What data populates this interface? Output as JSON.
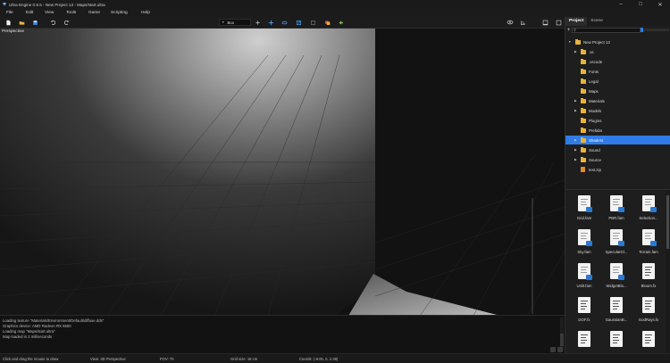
{
  "window": {
    "title": "Ultra Engine 0.9.5 - New Project 13 - Maps/start.ultra",
    "controls": [
      "–",
      "□",
      "✕"
    ]
  },
  "menu": [
    "File",
    "Edit",
    "View",
    "Tools",
    "Game",
    "Scripting",
    "Help"
  ],
  "toolbar": {
    "view_mode": "Box",
    "icons": [
      "new-file-icon",
      "open-folder-icon",
      "save-icon",
      "undo-icon",
      "redo-icon"
    ],
    "center_icons": [
      "add-icon",
      "move-icon",
      "rotate-icon",
      "scale-icon",
      "pivot-icon",
      "csg-icon",
      "run-icon"
    ],
    "right_icons": [
      "visibility-icon",
      "snap-icon",
      "layout-single-icon",
      "layout-quad-icon"
    ]
  },
  "viewport": {
    "label": "Perspective"
  },
  "console": {
    "lines": [
      "Loading texture \"Materials/Environment/Default/diffuse.dds\"",
      "Graphics device: AMD Radeon RX 6600",
      "Loading map \"Maps/start.ultra\"",
      "Map loaded in 2 milliseconds"
    ]
  },
  "statusbar": {
    "hint": "Click and drag the mouse to draw",
    "view": "View: 3D Perspective",
    "fov": "FOV: 70",
    "grid": "Grid size: 16 cm",
    "coords": "Coords: (-9.05, 0, 2.38)"
  },
  "panel": {
    "tabs": [
      "Project",
      "Scene"
    ],
    "active_tab": "Project",
    "search": {
      "placeholder": "",
      "value": ""
    },
    "tree": [
      {
        "label": "New Project 13",
        "type": "folder",
        "depth": 0,
        "expanded": true
      },
      {
        "label": ".vs",
        "type": "folder",
        "depth": 1,
        "expandable": true
      },
      {
        "label": ".vscode",
        "type": "folder",
        "depth": 1
      },
      {
        "label": "Fonts",
        "type": "folder",
        "depth": 1
      },
      {
        "label": "Legal",
        "type": "folder",
        "depth": 1
      },
      {
        "label": "Maps",
        "type": "folder",
        "depth": 1
      },
      {
        "label": "Materials",
        "type": "folder",
        "depth": 1,
        "expandable": true
      },
      {
        "label": "Models",
        "type": "folder",
        "depth": 1,
        "expandable": true
      },
      {
        "label": "Plugins",
        "type": "folder",
        "depth": 1
      },
      {
        "label": "Prefabs",
        "type": "folder",
        "depth": 1
      },
      {
        "label": "Shaders",
        "type": "folder",
        "depth": 1,
        "expandable": true,
        "selected": true
      },
      {
        "label": "Sound",
        "type": "folder",
        "depth": 1,
        "expandable": true
      },
      {
        "label": "Source",
        "type": "folder",
        "depth": 1,
        "expandable": true
      },
      {
        "label": "test.zip",
        "type": "zip",
        "depth": 1
      }
    ],
    "files": [
      "Grid.fam",
      "PBR.fam",
      "Selection...",
      "Sky.fam",
      "SpecularGl...",
      "Terrain.fam",
      "Unlit.fam",
      "WidgetBlo...",
      "Bloom.fx",
      "DOF.fx",
      "GaussianB...",
      "GodRays.fx",
      "",
      "",
      ""
    ]
  },
  "colors": {
    "accent": "#2f7ce8",
    "folder": "#e8b33c",
    "zip": "#e9892e",
    "badge": "#2979d6"
  }
}
